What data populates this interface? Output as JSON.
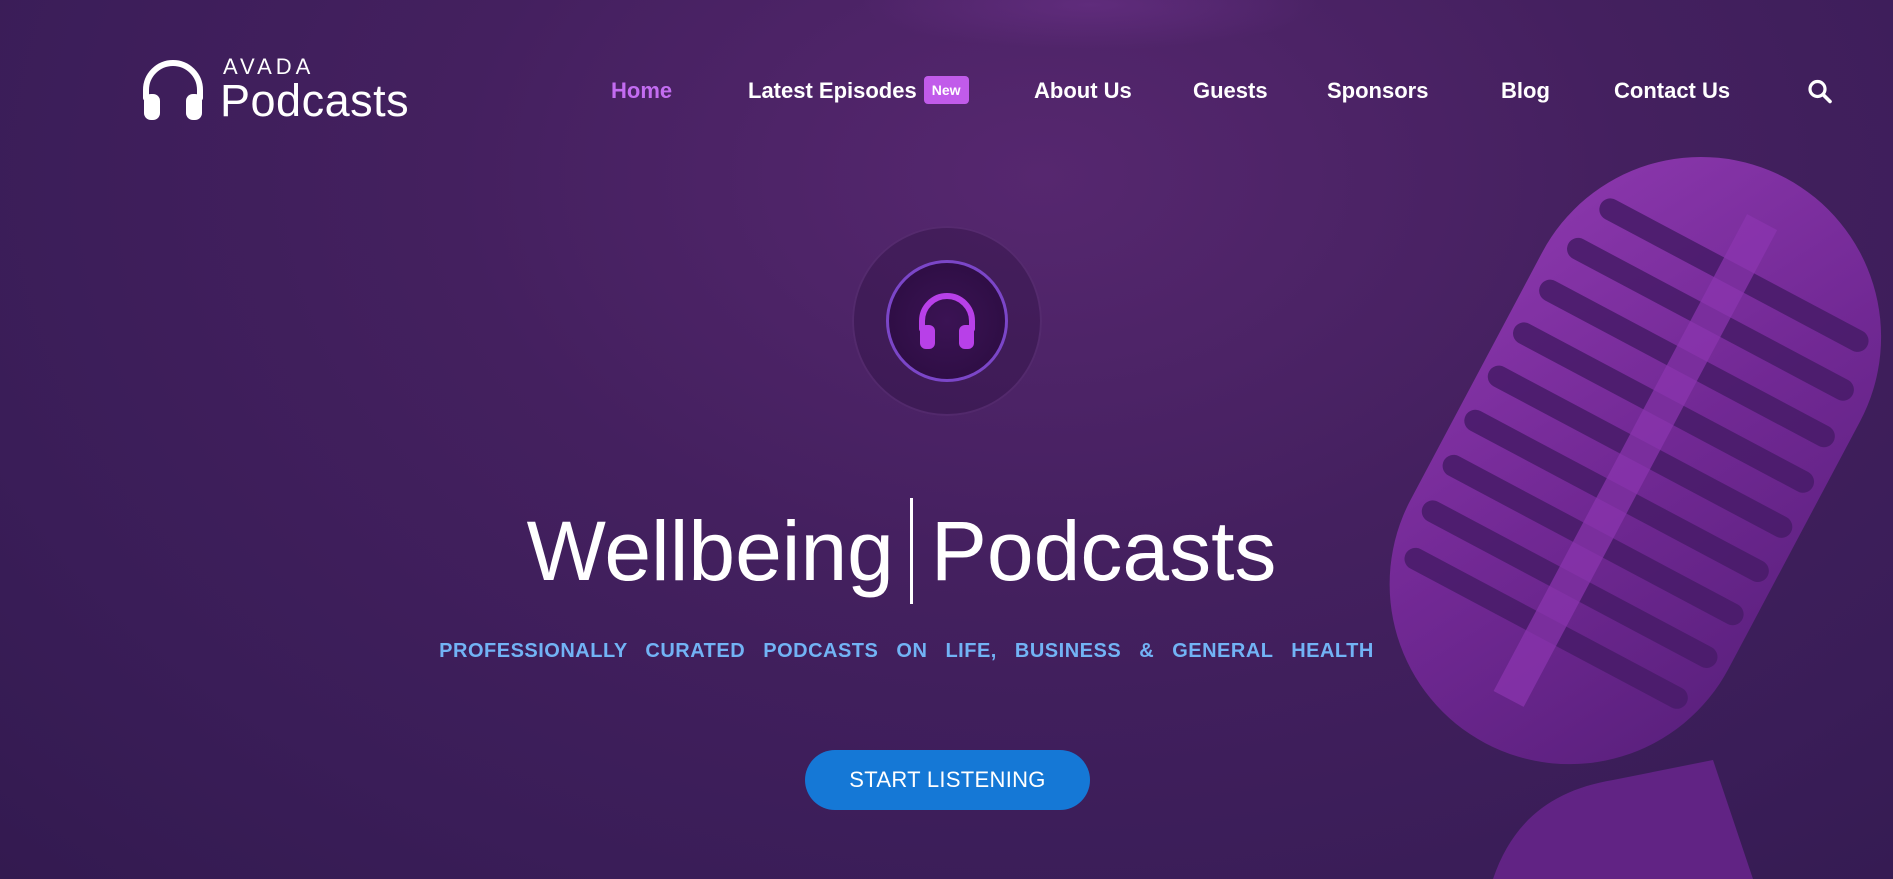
{
  "brand": {
    "line1": "AVADA",
    "line2": "Podcasts"
  },
  "nav": {
    "items": [
      {
        "label": "Home",
        "active": true
      },
      {
        "label": "Latest Episodes",
        "badge": "New"
      },
      {
        "label": "About Us"
      },
      {
        "label": "Guests"
      },
      {
        "label": "Sponsors"
      },
      {
        "label": "Blog"
      },
      {
        "label": "Contact Us"
      }
    ],
    "search_icon": "search-icon"
  },
  "hero": {
    "emblem_icon": "headphones-icon",
    "title_left": "Wellbeing",
    "title_right": "Podcasts",
    "subtitle": "PROFESSIONALLY CURATED PODCASTS ON LIFE, BUSINESS & GENERAL HEALTH",
    "cta_label": "START LISTENING"
  },
  "colors": {
    "background": "#44205f",
    "active_nav": "#c36cf1",
    "badge": "#c15bea",
    "subtitle": "#72b3f5",
    "cta": "#1578d6",
    "emblem_accent": "#b840e8"
  }
}
